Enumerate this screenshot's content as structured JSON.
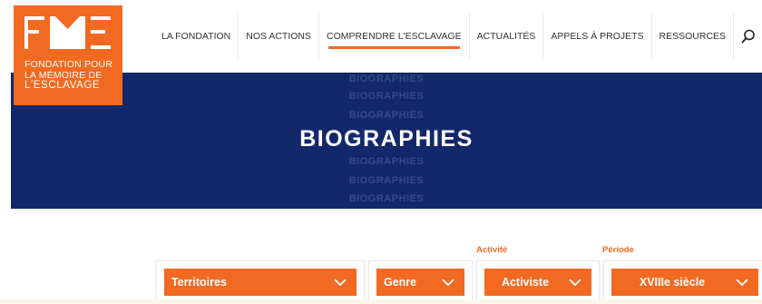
{
  "logo": {
    "lines": [
      "FONDATION POUR",
      "LA MÉMOIRE DE",
      "L'ESCLAVAGE"
    ],
    "color": "#f26a21"
  },
  "nav": {
    "items": [
      {
        "label": "LA FONDATION",
        "active": false
      },
      {
        "label": "NOS ACTIONS",
        "active": false
      },
      {
        "label": "COMPRENDRE L'ESCLAVAGE",
        "active": true
      },
      {
        "label": "ACTUALITÉS",
        "active": false
      },
      {
        "label": "APPELS À PROJETS",
        "active": false
      },
      {
        "label": "RESSOURCES",
        "active": false
      }
    ],
    "search_icon": "search-icon"
  },
  "banner": {
    "title": "BIOGRAPHIES",
    "ghost_text": "BIOGRAPHIES",
    "background": "#13286b"
  },
  "filters": {
    "territoires": {
      "value": "Territoires"
    },
    "genre": {
      "value": "Genre"
    },
    "activite": {
      "label": "Activité",
      "value": "Activiste"
    },
    "periode": {
      "label": "Période",
      "value": "XVIIIe siècle"
    },
    "chevron_icon": "chevron-down-icon",
    "accent": "#f26a21"
  }
}
